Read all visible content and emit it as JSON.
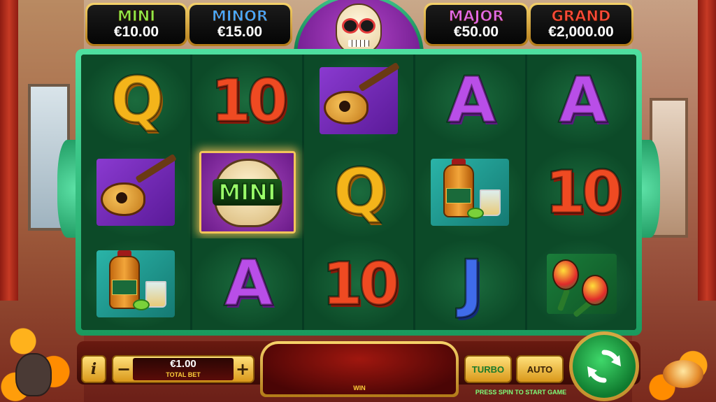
{
  "jackpots": {
    "mini": {
      "label": "MINI",
      "value": "€10.00",
      "color": "#8fe84a"
    },
    "minor": {
      "label": "MINOR",
      "value": "€15.00",
      "color": "#4aa8ff"
    },
    "major": {
      "label": "MAJOR",
      "value": "€50.00",
      "color": "#e06ae8"
    },
    "grand": {
      "label": "GRAND",
      "value": "€2,000.00",
      "color": "#ff4a3a"
    }
  },
  "reels": [
    [
      "Q",
      "10",
      "guitar",
      "A",
      "A"
    ],
    [
      "guitar",
      "mini-skull",
      "Q",
      "tequila",
      "10"
    ],
    [
      "tequila",
      "A",
      "10",
      "J",
      "maracas"
    ]
  ],
  "mini_symbol_label": "MINI",
  "controls": {
    "info_label": "i",
    "minus_label": "−",
    "plus_label": "+",
    "bet_amount": "€1.00",
    "bet_caption": "TOTAL BET",
    "win_label": "WIN",
    "turbo_label": "TURBO",
    "auto_label": "AUTO",
    "spin_hint": "PRESS SPIN TO START GAME"
  },
  "icons": {
    "spin": "spin-arrows-icon",
    "info": "info-icon"
  },
  "colors": {
    "frame": "#2fbf7a",
    "gold": "#f2c45a",
    "spin_green": "#1fb34a"
  }
}
